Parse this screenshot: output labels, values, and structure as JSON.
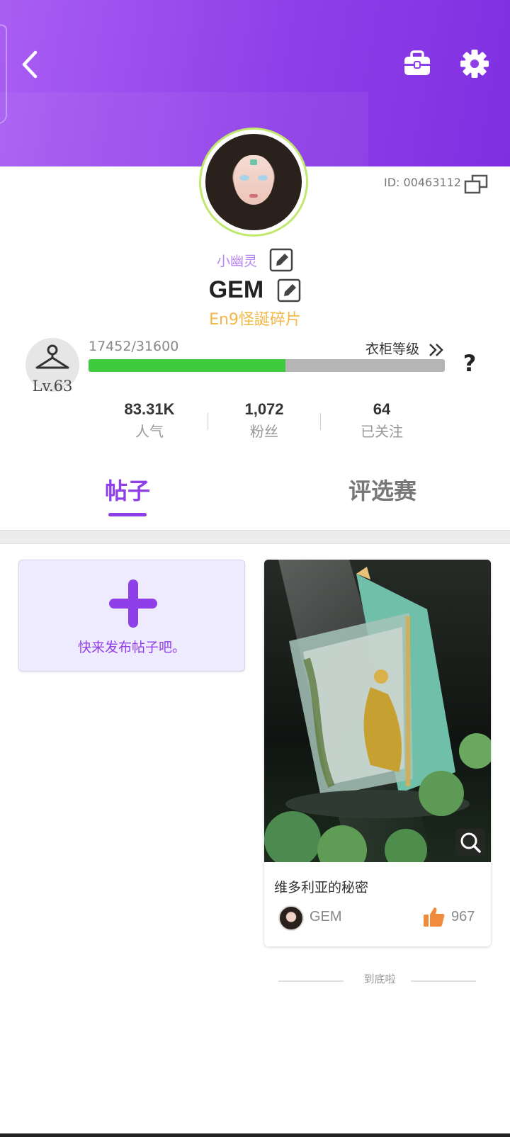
{
  "profile": {
    "id_text": "ID: 00463112",
    "nickname": "小幽灵",
    "username": "GEM",
    "title": "En9怪誕碎片",
    "level_label": "Lv.63",
    "xp_text": "17452/31600",
    "xp_progress": 0.552,
    "wardrobe_label": "衣柜等级",
    "help_label": "?"
  },
  "stats": [
    {
      "value": "83.31K",
      "label": "人气"
    },
    {
      "value": "1,072",
      "label": "粉丝"
    },
    {
      "value": "64",
      "label": "已关注"
    }
  ],
  "tabs": [
    {
      "label": "帖子",
      "active": true
    },
    {
      "label": "评选赛",
      "active": false
    }
  ],
  "new_post": {
    "label": "快来发布帖子吧。"
  },
  "posts": [
    {
      "title": "维多利亚的秘密",
      "author": "GEM",
      "likes": "967"
    }
  ],
  "footer": {
    "end_text": "到底啦"
  },
  "icons": {
    "back": "chevron-left-icon",
    "bag": "briefcase-icon",
    "settings": "gear-icon",
    "copy": "copy-icon",
    "edit": "pencil-icon",
    "hanger": "hanger-icon",
    "chevron": "double-chevron-right-icon",
    "plus": "plus-icon",
    "zoom": "magnifier-icon",
    "like": "thumbs-up-icon"
  },
  "colors": {
    "accent": "#8f3fe8",
    "progress": "#3fcc3c",
    "title_gold": "#f2b744",
    "like_orange": "#f08a3c"
  }
}
